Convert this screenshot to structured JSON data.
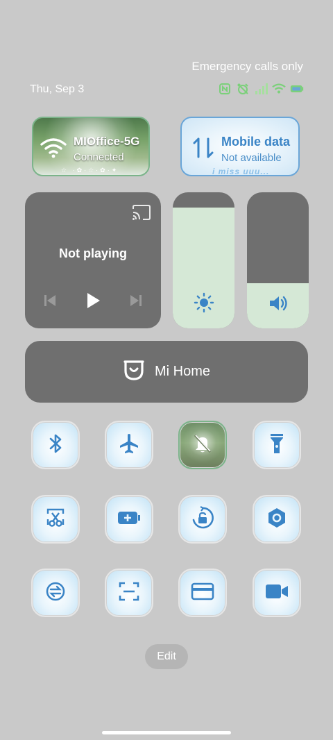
{
  "status_bar": {
    "carrier_text": "Emergency calls only",
    "date": "Thu, Sep 3"
  },
  "wifi_tile": {
    "name": "MIOffice-5G",
    "status": "Connected",
    "deco": "☆ ·✿·☆·✿·✦"
  },
  "mobile_data_tile": {
    "name": "Mobile data",
    "status": "Not available",
    "deco": "i miss uuu..."
  },
  "media": {
    "title": "Not playing"
  },
  "brightness": {
    "level": 0.89
  },
  "volume": {
    "level": 0.33
  },
  "mi_home": {
    "label": "Mi Home"
  },
  "edit": {
    "label": "Edit"
  },
  "colors": {
    "accent": "#3a84c6",
    "tile_dark": "#6f6f6f",
    "slider_fill": "#d5e8d6",
    "background": "#c9c9c9"
  }
}
